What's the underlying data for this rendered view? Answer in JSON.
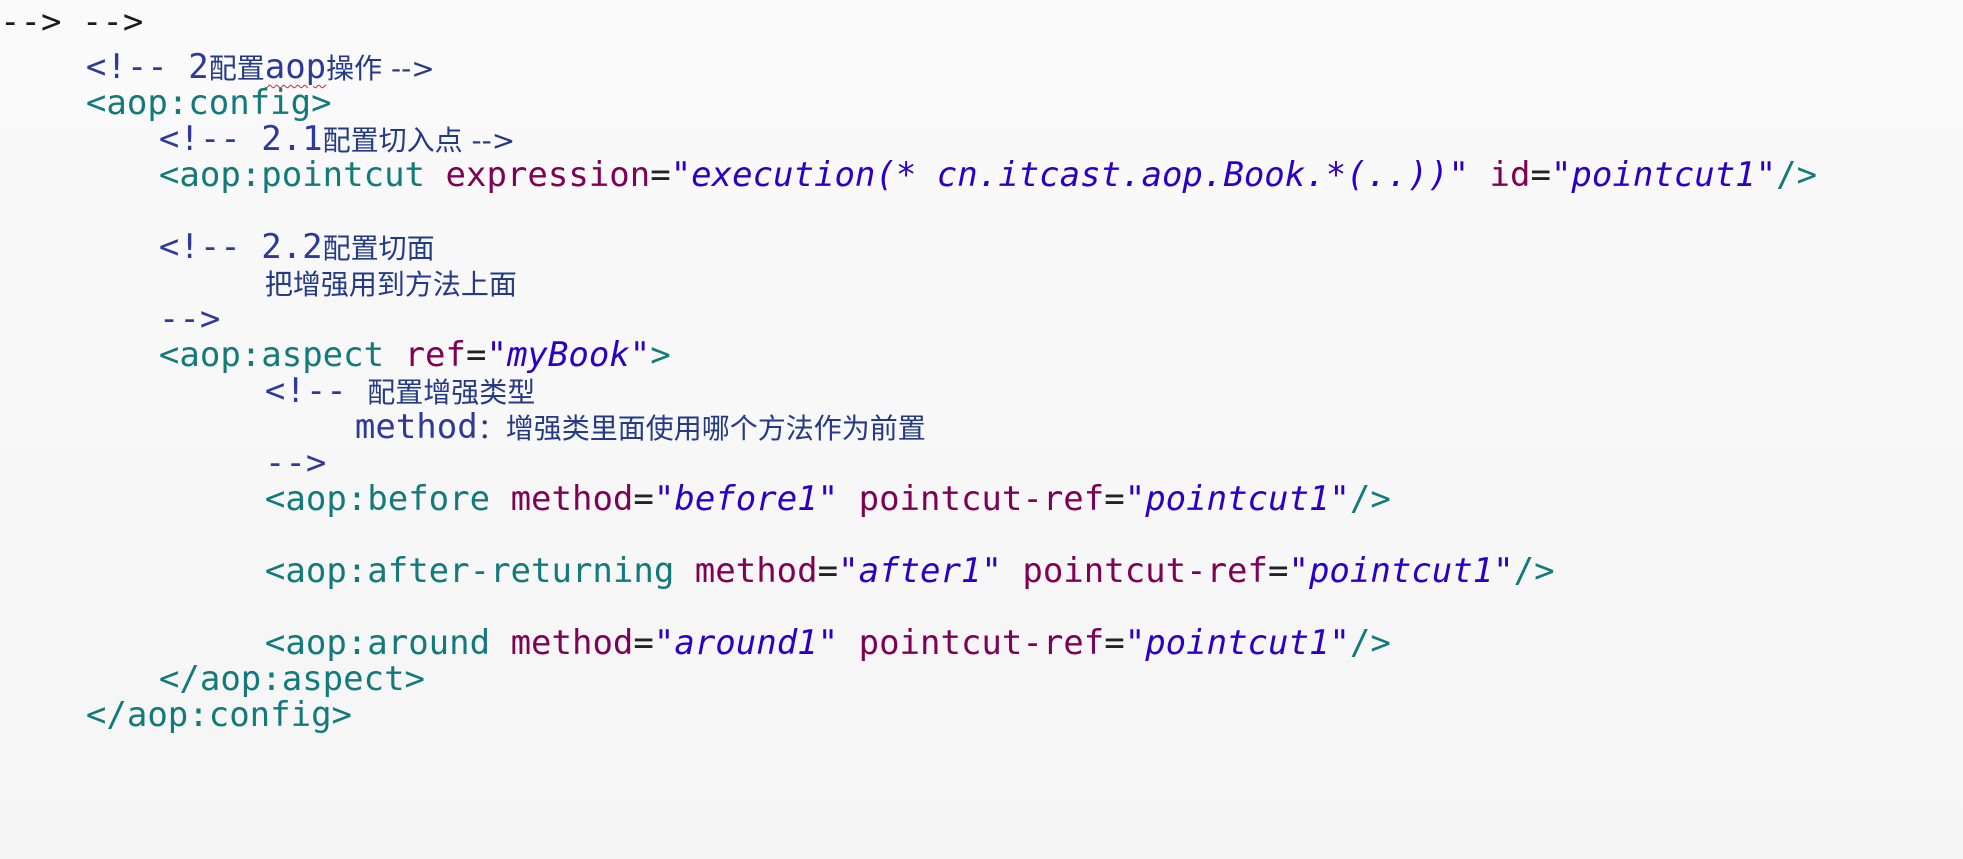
{
  "code_lines": [
    {
      "c1": "<!-- 2",
      "c2": "配置",
      "c3": "aop",
      "c4": "操作 -->"
    },
    {
      "open": "<",
      "tag": "aop:config",
      "close": ">"
    },
    {
      "c1": "<!-- 2.1",
      "c2": "配置切入点 -->"
    },
    {
      "open": "<",
      "tag": "aop:pointcut",
      "a1": "expression",
      "v1": "\"execution(* cn.itcast.aop.Book.*(..))\"",
      "a2": "id",
      "v2": "\"pointcut1\"",
      "close": "/>"
    },
    {
      "c1": "<!-- 2.2",
      "c2": "配置切面"
    },
    {
      "c2": "把增强用到方法上面"
    },
    {
      "c1": "-->"
    },
    {
      "open": "<",
      "tag": "aop:aspect",
      "a1": "ref",
      "v1": "\"myBook\"",
      "close": ">"
    },
    {
      "c1": "<!--",
      "c2": "配置增强类型"
    },
    {
      "c1": "method",
      "c2": "：增强类里面使用哪个方法作为前置"
    },
    {
      "c1": "-->"
    },
    {
      "open": "<",
      "tag": "aop:before",
      "a1": "method",
      "v1": "\"before1\"",
      "a2": "pointcut-ref",
      "v2": "\"pointcut1\"",
      "close": "/>"
    },
    {
      "open": "<",
      "tag": "aop:after-returning",
      "a1": "method",
      "v1": "\"after1\"",
      "a2": "pointcut-ref",
      "v2": "\"pointcut1\"",
      "close": "/>"
    },
    {
      "open": "<",
      "tag": "aop:around",
      "a1": "method",
      "v1": "\"around1\"",
      "a2": "pointcut-ref",
      "v2": "\"pointcut1\"",
      "close": "/>"
    },
    {
      "open": "</",
      "tag": "aop:aspect",
      "close": ">"
    },
    {
      "open": "</",
      "tag": "aop:config",
      "close": ">"
    }
  ]
}
